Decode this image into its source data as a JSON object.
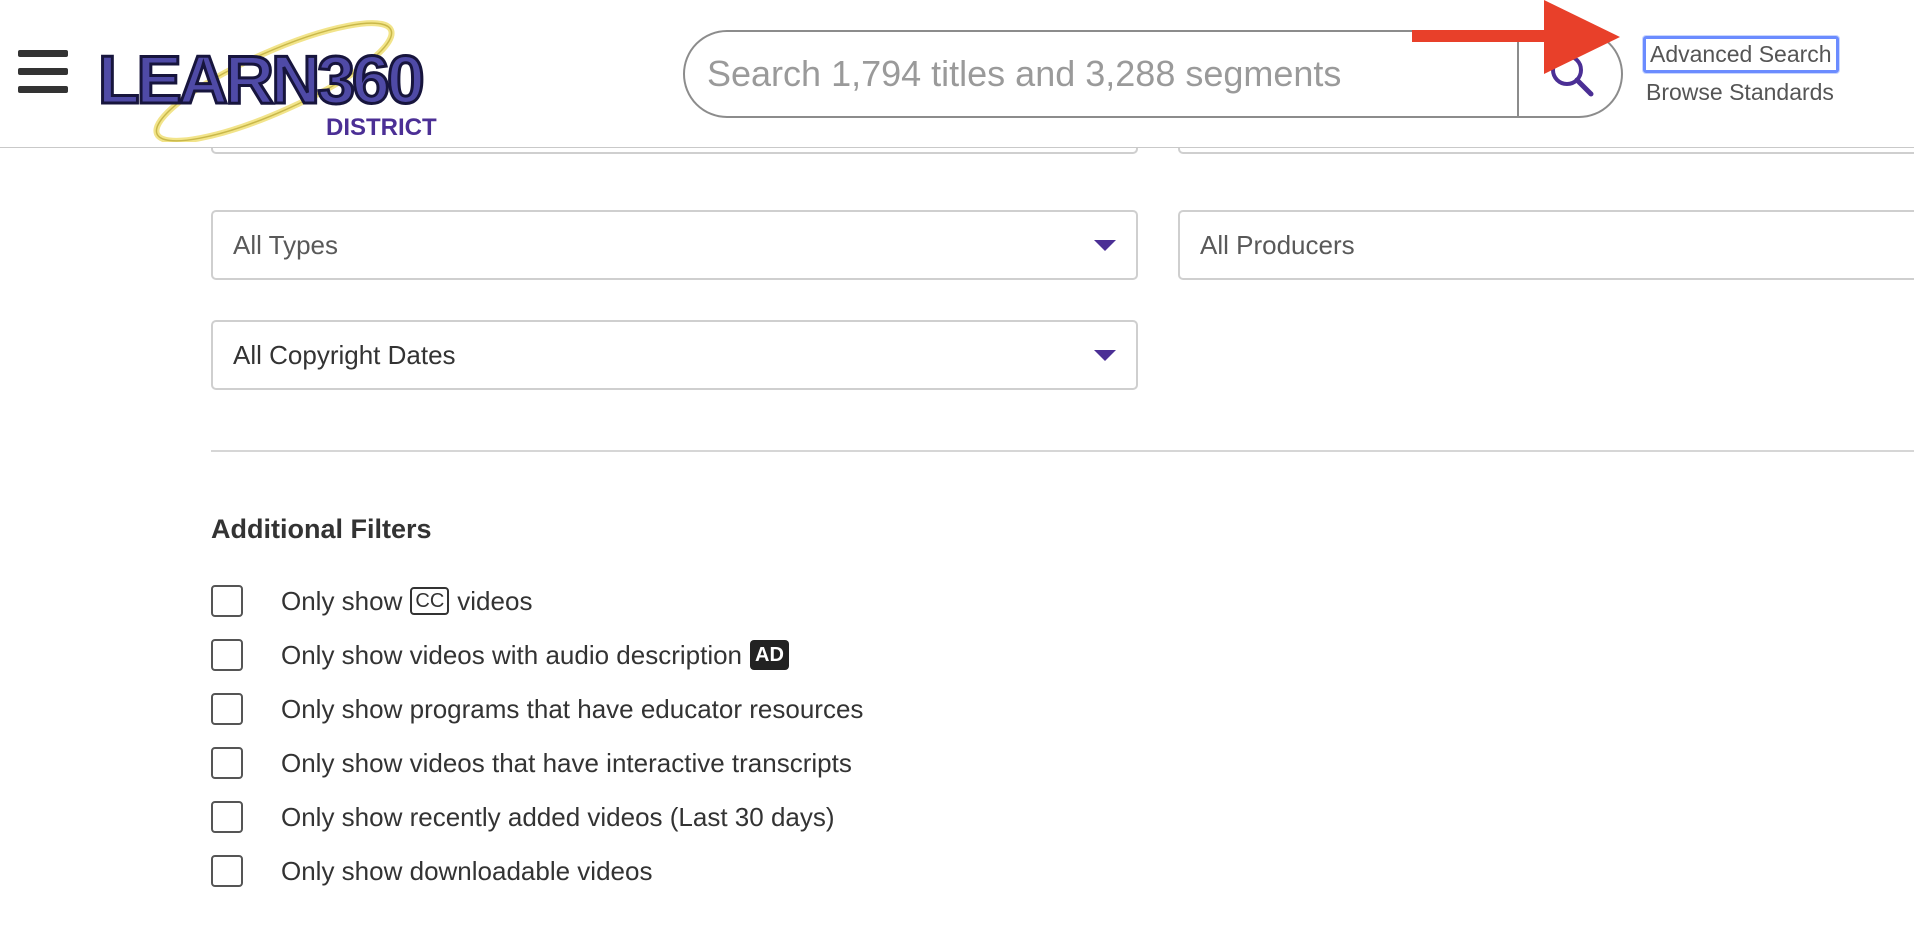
{
  "header": {
    "menu_icon": "hamburger-menu-icon",
    "logo": {
      "wordmark": "LEARN360",
      "subtitle": "DISTRICT"
    },
    "search": {
      "placeholder": "Search 1,794 titles and 3,288 segments",
      "value": "",
      "button_icon": "magnifier-icon"
    },
    "links": {
      "advanced_search": "Advanced Search",
      "browse_standards": "Browse Standards"
    }
  },
  "filters": {
    "selects": {
      "types": "All Types",
      "producers": "All Producers",
      "copyright_dates": "All Copyright Dates"
    }
  },
  "additional_filters": {
    "heading": "Additional Filters",
    "options": [
      {
        "text_before": "Only show",
        "badge": "CC",
        "text_after": "videos",
        "checked": false
      },
      {
        "text": "Only show videos with audio description",
        "badge": "AD",
        "checked": false
      },
      {
        "text": "Only show programs that have educator resources",
        "checked": false
      },
      {
        "text": "Only show videos that have interactive transcripts",
        "checked": false
      },
      {
        "text": "Only show recently added videos (Last 30 days)",
        "checked": false
      },
      {
        "text": "Only show downloadable videos",
        "checked": false
      }
    ]
  },
  "colors": {
    "brand_purple": "#4b2f95",
    "focus_outline": "#6b8cff",
    "annotation_arrow": "#e8402a"
  }
}
